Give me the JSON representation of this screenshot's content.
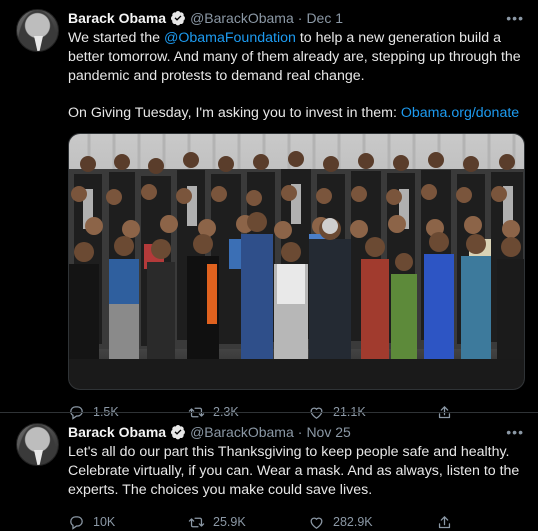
{
  "tweets": [
    {
      "author_name": "Barack Obama",
      "handle": "@BarackObama",
      "separator": "·",
      "date": "Dec 1",
      "more": "•••",
      "text_lines": {
        "p1_a": "We started the ",
        "p1_link": "@ObamaFoundation",
        "p1_b": " to help a new generation build a better tomorrow. And many of them already are, stepping up through the pandemic and protests to demand real change.",
        "p2_a": "On Giving Tuesday, I'm asking you to invest in them: ",
        "p2_link": "Obama.org/donate"
      },
      "stats": {
        "replies": "1.5K",
        "retweets": "2.3K",
        "likes": "21.1K"
      }
    },
    {
      "author_name": "Barack Obama",
      "handle": "@BarackObama",
      "separator": "·",
      "date": "Nov 25",
      "more": "•••",
      "text": "Let's all do our part this Thanksgiving to keep people safe and healthy. Celebrate virtually, if you can. Wear a mask. And as always, listen to the experts. The choices you make could save lives.",
      "stats": {
        "replies": "10K",
        "retweets": "25.9K",
        "likes": "282.9K"
      }
    }
  ],
  "colors": {
    "background": "#000000",
    "link": "#1d9bf0",
    "verified": "#1d9bf0",
    "muted": "#8b98a5",
    "divider": "#2f3336"
  },
  "icons": {
    "reply": "reply-icon",
    "retweet": "retweet-icon",
    "like": "heart-icon",
    "share": "share-icon",
    "verified": "verified-badge-icon"
  }
}
